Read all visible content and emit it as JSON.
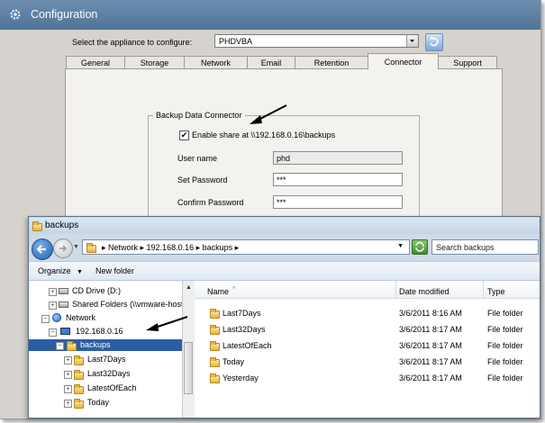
{
  "config": {
    "title": "Configuration",
    "appliance_label": "Select the appliance to configure:",
    "appliance_value": "PHDVBA",
    "tabs": [
      "General",
      "Storage",
      "Network",
      "Email",
      "Retention",
      "Connector",
      "Support"
    ],
    "active_tab": "Connector",
    "group_title": "Backup Data Connector",
    "enable_label": "Enable share at \\\\192.168.0.16\\backups",
    "enable_checked": true,
    "user_label": "User name",
    "user_value": "phd",
    "password_label": "Set Password",
    "password_value": "***",
    "confirm_label": "Confirm Password",
    "confirm_value": "***"
  },
  "explorer": {
    "title": "backups",
    "breadcrumb": "▸ Network ▸ 192.168.0.16 ▸ backups ▸",
    "search_placeholder": "Search backups",
    "organize_label": "Organize",
    "new_folder_label": "New folder",
    "tree": [
      {
        "label": "CD Drive (D:)",
        "icon": "drive-icon"
      },
      {
        "label": "Shared Folders (\\\\vmware-host",
        "icon": "drive-icon"
      },
      {
        "label": "Network",
        "icon": "network-icon"
      },
      {
        "label": "192.168.0.16",
        "icon": "computer-icon"
      },
      {
        "label": "backups",
        "icon": "folder-icon",
        "selected": true
      },
      {
        "label": "Last7Days",
        "icon": "folder-icon"
      },
      {
        "label": "Last32Days",
        "icon": "folder-icon"
      },
      {
        "label": "LatestOfEach",
        "icon": "folder-icon"
      },
      {
        "label": "Today",
        "icon": "folder-icon"
      }
    ],
    "columns": [
      "Name",
      "Date modified",
      "Type"
    ],
    "files": [
      {
        "name": "Last7Days",
        "date": "3/6/2011 8:16 AM",
        "type": "File folder"
      },
      {
        "name": "Last32Days",
        "date": "3/6/2011 8:17 AM",
        "type": "File folder"
      },
      {
        "name": "LatestOfEach",
        "date": "3/6/2011 8:17 AM",
        "type": "File folder"
      },
      {
        "name": "Today",
        "date": "3/6/2011 8:17 AM",
        "type": "File folder"
      },
      {
        "name": "Yesterday",
        "date": "3/6/2011 8:17 AM",
        "type": "File folder"
      }
    ]
  }
}
